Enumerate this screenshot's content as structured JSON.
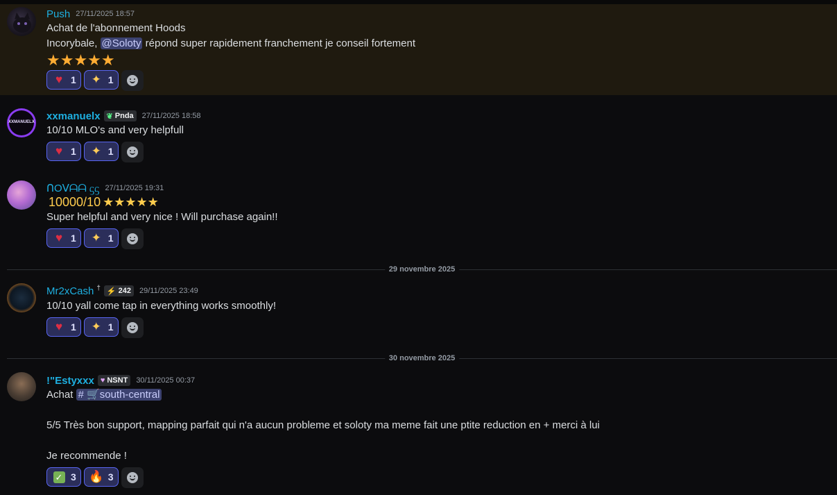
{
  "messages": [
    {
      "username": "Push",
      "timestamp": "27/11/2025 18:57",
      "lines": [
        "Achat de l'abonnement Hoods"
      ],
      "line2_prefix": "Incorybale, ",
      "line2_mention": "@Soloty",
      "line2_suffix": " répond super rapidement franchement je conseil fortement",
      "stars": "★★★★★",
      "reactions": [
        {
          "emoji": "heart",
          "count": "1"
        },
        {
          "emoji": "sparkles",
          "count": "1"
        }
      ]
    },
    {
      "username": "xxmanuelx",
      "avatar_text": "XXMANUELX",
      "tag_text": "Pnda",
      "tag_icon": "leaf-icon",
      "timestamp": "27/11/2025 18:58",
      "line1": "10/10 MLO's and very helpfull",
      "reactions": [
        {
          "emoji": "heart",
          "count": "1"
        },
        {
          "emoji": "sparkles",
          "count": "1"
        }
      ]
    },
    {
      "username": "ᑎOᐯᗩᗩ ᦓᦓ",
      "timestamp": "27/11/2025 19:31",
      "line1": "10000/10",
      "stars": "★★★★★",
      "line2": "Super helpful and very nice ! Will purchase again!!",
      "reactions": [
        {
          "emoji": "heart",
          "count": "1"
        },
        {
          "emoji": "sparkles",
          "count": "1"
        }
      ]
    },
    {
      "username": "Mr2xCash",
      "sup": "†",
      "tag_text": "242",
      "tag_icon": "lightning-icon",
      "timestamp": "29/11/2025 23:49",
      "line1": "10/10 yall come tap in everything works smoothly!",
      "reactions": [
        {
          "emoji": "heart",
          "count": "1"
        },
        {
          "emoji": "sparkles",
          "count": "1"
        }
      ]
    },
    {
      "username": "!\"Estyxxx",
      "tag_text": "NSNT",
      "tag_icon": "heart-icon",
      "timestamp": "30/11/2025 00:37",
      "line1_prefix": "Achat ",
      "channel": "south-central",
      "line2": "5/5 Très bon support, mapping parfait qui n'a aucun probleme et soloty ma meme fait une ptite reduction en + merci à lui",
      "line3": "Je recommende !",
      "reactions": [
        {
          "emoji": "check",
          "count": "3"
        },
        {
          "emoji": "fire",
          "count": "3"
        }
      ]
    }
  ],
  "dividers": [
    "29 novembre 2025",
    "30 novembre 2025"
  ],
  "colors": {
    "username": "#1eafe0",
    "mention_bg": "#3c4270",
    "reaction_border": "#5865f2",
    "highlight_bg": "#1f1a0f"
  }
}
